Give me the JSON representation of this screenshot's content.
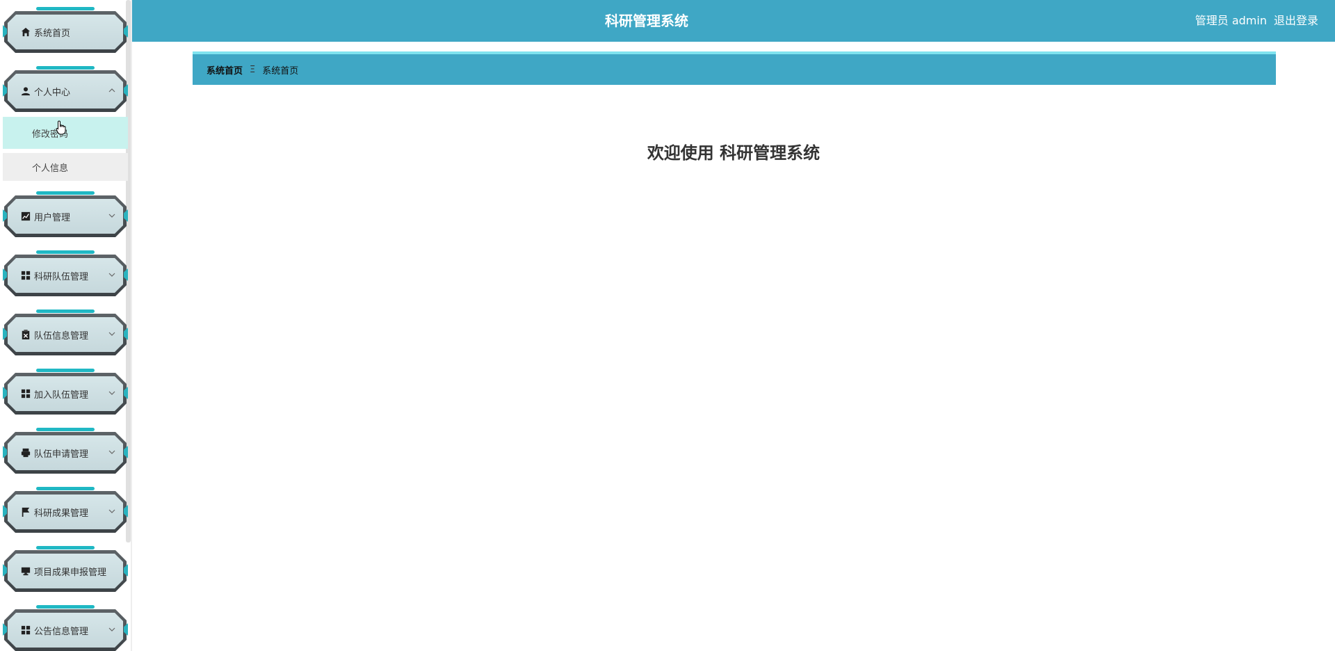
{
  "header": {
    "title": "科研管理系统",
    "user_label": "管理员 admin",
    "logout_label": "退出登录"
  },
  "breadcrumb": {
    "home": "系统首页",
    "separator": "Ξ",
    "current": "系统首页"
  },
  "main": {
    "welcome": "欢迎使用 科研管理系统"
  },
  "sidebar": {
    "items": [
      {
        "label": "系统首页",
        "icon": "home-icon"
      },
      {
        "label": "个人中心",
        "icon": "user-icon",
        "expanded": true,
        "children": [
          {
            "label": "修改密码",
            "active": true
          },
          {
            "label": "个人信息"
          }
        ]
      },
      {
        "label": "用户管理",
        "icon": "chart-icon"
      },
      {
        "label": "科研队伍管理",
        "icon": "grid-icon"
      },
      {
        "label": "队伍信息管理",
        "icon": "clipboard-icon"
      },
      {
        "label": "加入队伍管理",
        "icon": "grid-icon"
      },
      {
        "label": "队伍申请管理",
        "icon": "printer-icon"
      },
      {
        "label": "科研成果管理",
        "icon": "flag-icon"
      },
      {
        "label": "项目成果申报管理",
        "icon": "monitor-icon"
      },
      {
        "label": "公告信息管理",
        "icon": "grid-icon"
      }
    ]
  },
  "colors": {
    "accent": "#3fa7c5",
    "active_sub": "#c8f2ee"
  }
}
